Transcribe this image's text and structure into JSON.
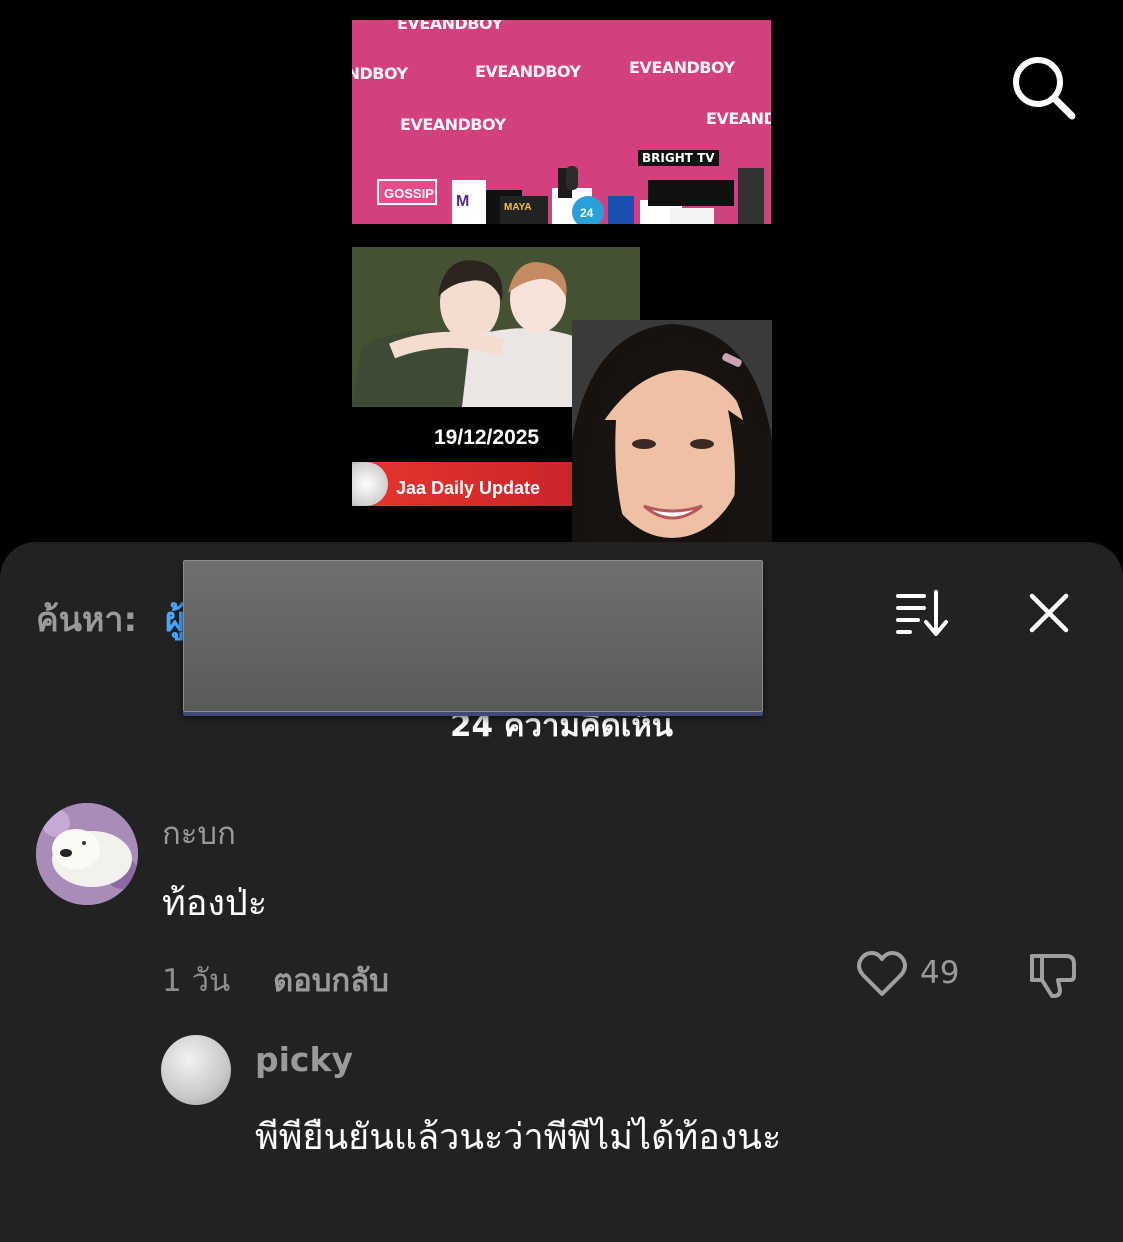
{
  "video": {
    "watermark": "EVEANDBOY",
    "brand_logo_text": "BRIGHT TV",
    "date": "19/12/2025",
    "banner": "Jaa Daily Update"
  },
  "comments_panel": {
    "search_prefix": "ค้นหา:",
    "search_link_visible": "ผู้",
    "title": "24 ความคิดเห็น",
    "comments": [
      {
        "author": "กะบก",
        "text": "ท้องป่ะ",
        "time": "1 วัน",
        "reply_label": "ตอบกลับ",
        "likes": "49"
      },
      {
        "author": "picky",
        "text": "พีพียืนยันแล้วนะว่าพีพีไม่ได้ท้องนะ"
      }
    ]
  },
  "icons": {
    "search": "search-icon",
    "sort": "sort-icon",
    "close": "close-icon",
    "like": "heart-icon",
    "dislike": "thumbs-down-icon"
  },
  "colors": {
    "sheet_bg": "#222223",
    "link_blue": "#4aa6ff",
    "video_pink": "#d2407e",
    "banner_red": "#e8352e"
  }
}
